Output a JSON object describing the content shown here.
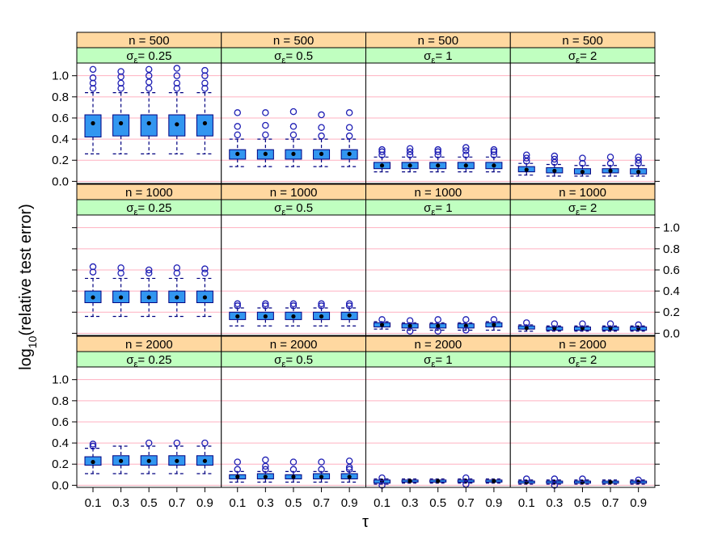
{
  "chart_data": {
    "type": "box",
    "xlabel": "τ",
    "ylabel": "log",
    "ylabel_sub": "10",
    "ylabel_rest": "(relative test error)",
    "strip_prefix_sigma": "σ",
    "strip_sub_eps": "ε",
    "x_ticks": [
      "0.1",
      "0.3",
      "0.5",
      "0.7",
      "0.9"
    ],
    "y_ticks": [
      "0.0",
      "0.2",
      "0.4",
      "0.6",
      "0.8",
      "1.0"
    ],
    "ylim": [
      -0.02,
      1.12
    ],
    "colors": {
      "n_strip": "#ffd8a0",
      "sigma_strip": "#c0ffc0",
      "box_fill": "#3296f0",
      "box_line": "#000080",
      "outlier": "#1e1eb4",
      "grid": "#ffb0c0",
      "panel_bg": "#ffffff"
    },
    "rows": [
      {
        "n_label": "n = 500",
        "panels": [
          {
            "sigma_label": "= 0.25",
            "boxes": [
              {
                "q1": 0.42,
                "med": 0.55,
                "q3": 0.63,
                "lo": 0.26,
                "hi": 0.84,
                "out": [
                  0.88,
                  0.93,
                  0.98,
                  1.06
                ]
              },
              {
                "q1": 0.43,
                "med": 0.55,
                "q3": 0.63,
                "lo": 0.26,
                "hi": 0.84,
                "out": [
                  0.88,
                  0.93,
                  0.99,
                  1.04
                ]
              },
              {
                "q1": 0.43,
                "med": 0.55,
                "q3": 0.63,
                "lo": 0.26,
                "hi": 0.84,
                "out": [
                  0.88,
                  0.94,
                  1.0,
                  1.06
                ]
              },
              {
                "q1": 0.43,
                "med": 0.54,
                "q3": 0.63,
                "lo": 0.26,
                "hi": 0.84,
                "out": [
                  0.88,
                  0.93,
                  1.0,
                  1.07
                ]
              },
              {
                "q1": 0.43,
                "med": 0.55,
                "q3": 0.63,
                "lo": 0.26,
                "hi": 0.84,
                "out": [
                  0.88,
                  0.93,
                  1.0,
                  1.05
                ]
              }
            ]
          },
          {
            "sigma_label": "= 0.5",
            "boxes": [
              {
                "q1": 0.21,
                "med": 0.26,
                "q3": 0.3,
                "lo": 0.14,
                "hi": 0.4,
                "out": [
                  0.44,
                  0.52,
                  0.65
                ]
              },
              {
                "q1": 0.21,
                "med": 0.26,
                "q3": 0.3,
                "lo": 0.14,
                "hi": 0.4,
                "out": [
                  0.44,
                  0.53,
                  0.65
                ]
              },
              {
                "q1": 0.21,
                "med": 0.26,
                "q3": 0.3,
                "lo": 0.14,
                "hi": 0.4,
                "out": [
                  0.44,
                  0.52,
                  0.66
                ]
              },
              {
                "q1": 0.21,
                "med": 0.26,
                "q3": 0.3,
                "lo": 0.14,
                "hi": 0.4,
                "out": [
                  0.43,
                  0.51,
                  0.63
                ]
              },
              {
                "q1": 0.21,
                "med": 0.26,
                "q3": 0.3,
                "lo": 0.14,
                "hi": 0.4,
                "out": [
                  0.43,
                  0.51,
                  0.65
                ]
              }
            ]
          },
          {
            "sigma_label": "= 1",
            "boxes": [
              {
                "q1": 0.12,
                "med": 0.15,
                "q3": 0.18,
                "lo": 0.09,
                "hi": 0.23,
                "out": [
                  0.25,
                  0.28,
                  0.3
                ]
              },
              {
                "q1": 0.12,
                "med": 0.15,
                "q3": 0.18,
                "lo": 0.09,
                "hi": 0.23,
                "out": [
                  0.25,
                  0.28,
                  0.31
                ]
              },
              {
                "q1": 0.12,
                "med": 0.15,
                "q3": 0.18,
                "lo": 0.09,
                "hi": 0.23,
                "out": [
                  0.25,
                  0.28,
                  0.3
                ]
              },
              {
                "q1": 0.12,
                "med": 0.15,
                "q3": 0.18,
                "lo": 0.09,
                "hi": 0.23,
                "out": [
                  0.25,
                  0.29,
                  0.32
                ]
              },
              {
                "q1": 0.12,
                "med": 0.15,
                "q3": 0.18,
                "lo": 0.09,
                "hi": 0.23,
                "out": [
                  0.25,
                  0.28,
                  0.3
                ]
              }
            ]
          },
          {
            "sigma_label": "= 2",
            "boxes": [
              {
                "q1": 0.09,
                "med": 0.11,
                "q3": 0.14,
                "lo": 0.06,
                "hi": 0.17,
                "out": [
                  0.19,
                  0.22,
                  0.25
                ]
              },
              {
                "q1": 0.08,
                "med": 0.1,
                "q3": 0.13,
                "lo": 0.05,
                "hi": 0.16,
                "out": [
                  0.18,
                  0.21,
                  0.24
                ]
              },
              {
                "q1": 0.07,
                "med": 0.09,
                "q3": 0.12,
                "lo": 0.05,
                "hi": 0.15,
                "out": [
                  0.17,
                  0.22
                ]
              },
              {
                "q1": 0.08,
                "med": 0.1,
                "q3": 0.12,
                "lo": 0.05,
                "hi": 0.15,
                "out": [
                  0.17,
                  0.23
                ]
              },
              {
                "q1": 0.07,
                "med": 0.09,
                "q3": 0.12,
                "lo": 0.05,
                "hi": 0.15,
                "out": [
                  0.17,
                  0.2,
                  0.23
                ]
              }
            ]
          }
        ]
      },
      {
        "n_label": "n = 1000",
        "panels": [
          {
            "sigma_label": "= 0.25",
            "boxes": [
              {
                "q1": 0.29,
                "med": 0.34,
                "q3": 0.4,
                "lo": 0.16,
                "hi": 0.52,
                "out": [
                  0.58,
                  0.63
                ]
              },
              {
                "q1": 0.29,
                "med": 0.34,
                "q3": 0.4,
                "lo": 0.16,
                "hi": 0.52,
                "out": [
                  0.57,
                  0.62
                ]
              },
              {
                "q1": 0.29,
                "med": 0.34,
                "q3": 0.4,
                "lo": 0.16,
                "hi": 0.52,
                "out": [
                  0.57,
                  0.6
                ]
              },
              {
                "q1": 0.29,
                "med": 0.34,
                "q3": 0.4,
                "lo": 0.16,
                "hi": 0.52,
                "out": [
                  0.57,
                  0.62
                ]
              },
              {
                "q1": 0.29,
                "med": 0.34,
                "q3": 0.4,
                "lo": 0.16,
                "hi": 0.52,
                "out": [
                  0.57,
                  0.61
                ]
              }
            ]
          },
          {
            "sigma_label": "= 0.5",
            "boxes": [
              {
                "q1": 0.13,
                "med": 0.16,
                "q3": 0.2,
                "lo": 0.07,
                "hi": 0.24,
                "out": [
                  0.26,
                  0.28
                ]
              },
              {
                "q1": 0.13,
                "med": 0.16,
                "q3": 0.2,
                "lo": 0.07,
                "hi": 0.24,
                "out": [
                  0.26,
                  0.28
                ]
              },
              {
                "q1": 0.13,
                "med": 0.16,
                "q3": 0.2,
                "lo": 0.07,
                "hi": 0.24,
                "out": [
                  0.26,
                  0.28
                ]
              },
              {
                "q1": 0.13,
                "med": 0.16,
                "q3": 0.2,
                "lo": 0.07,
                "hi": 0.24,
                "out": [
                  0.26,
                  0.28
                ]
              },
              {
                "q1": 0.13,
                "med": 0.17,
                "q3": 0.2,
                "lo": 0.07,
                "hi": 0.24,
                "out": [
                  0.26,
                  0.28
                ]
              }
            ]
          },
          {
            "sigma_label": "= 1",
            "boxes": [
              {
                "q1": 0.06,
                "med": 0.08,
                "q3": 0.1,
                "lo": 0.04,
                "hi": 0.11,
                "out": [
                  0.13
                ]
              },
              {
                "q1": 0.05,
                "med": 0.07,
                "q3": 0.09,
                "lo": 0.03,
                "hi": 0.1,
                "out": [
                  0.02,
                  0.12
                ]
              },
              {
                "q1": 0.05,
                "med": 0.07,
                "q3": 0.09,
                "lo": 0.03,
                "hi": 0.1,
                "out": [
                  0.02,
                  0.13
                ]
              },
              {
                "q1": 0.05,
                "med": 0.07,
                "q3": 0.09,
                "lo": 0.03,
                "hi": 0.1,
                "out": [
                  0.03,
                  0.13
                ]
              },
              {
                "q1": 0.06,
                "med": 0.08,
                "q3": 0.1,
                "lo": 0.03,
                "hi": 0.11,
                "out": [
                  0.13
                ]
              }
            ]
          },
          {
            "sigma_label": "= 2",
            "boxes": [
              {
                "q1": 0.04,
                "med": 0.05,
                "q3": 0.07,
                "lo": 0.02,
                "hi": 0.08,
                "out": [
                  0.1
                ]
              },
              {
                "q1": 0.03,
                "med": 0.05,
                "q3": 0.06,
                "lo": 0.02,
                "hi": 0.07,
                "out": [
                  0.09
                ]
              },
              {
                "q1": 0.03,
                "med": 0.05,
                "q3": 0.06,
                "lo": 0.02,
                "hi": 0.07,
                "out": [
                  0.09
                ]
              },
              {
                "q1": 0.03,
                "med": 0.05,
                "q3": 0.06,
                "lo": 0.02,
                "hi": 0.07,
                "out": [
                  0.09
                ]
              },
              {
                "q1": 0.03,
                "med": 0.05,
                "q3": 0.06,
                "lo": 0.02,
                "hi": 0.07,
                "out": [
                  0.08
                ]
              }
            ]
          }
        ]
      },
      {
        "n_label": "n = 2000",
        "panels": [
          {
            "sigma_label": "= 0.25",
            "boxes": [
              {
                "q1": 0.19,
                "med": 0.22,
                "q3": 0.27,
                "lo": 0.11,
                "hi": 0.35,
                "out": [
                  0.37,
                  0.39
                ]
              },
              {
                "q1": 0.19,
                "med": 0.23,
                "q3": 0.28,
                "lo": 0.11,
                "hi": 0.37,
                "out": []
              },
              {
                "q1": 0.19,
                "med": 0.23,
                "q3": 0.28,
                "lo": 0.11,
                "hi": 0.37,
                "out": [
                  0.4
                ]
              },
              {
                "q1": 0.19,
                "med": 0.23,
                "q3": 0.28,
                "lo": 0.11,
                "hi": 0.37,
                "out": [
                  0.4
                ]
              },
              {
                "q1": 0.19,
                "med": 0.23,
                "q3": 0.28,
                "lo": 0.11,
                "hi": 0.37,
                "out": [
                  0.4
                ]
              }
            ]
          },
          {
            "sigma_label": "= 0.5",
            "boxes": [
              {
                "q1": 0.06,
                "med": 0.08,
                "q3": 0.1,
                "lo": 0.03,
                "hi": 0.13,
                "out": [
                  0.15,
                  0.22
                ]
              },
              {
                "q1": 0.06,
                "med": 0.08,
                "q3": 0.11,
                "lo": 0.03,
                "hi": 0.13,
                "out": [
                  0.15,
                  0.18,
                  0.24
                ]
              },
              {
                "q1": 0.06,
                "med": 0.08,
                "q3": 0.1,
                "lo": 0.03,
                "hi": 0.13,
                "out": [
                  0.15,
                  0.22
                ]
              },
              {
                "q1": 0.06,
                "med": 0.08,
                "q3": 0.11,
                "lo": 0.03,
                "hi": 0.13,
                "out": [
                  0.15,
                  0.22
                ]
              },
              {
                "q1": 0.06,
                "med": 0.08,
                "q3": 0.11,
                "lo": 0.03,
                "hi": 0.13,
                "out": [
                  0.15,
                  0.17,
                  0.23
                ]
              }
            ]
          },
          {
            "sigma_label": "= 1",
            "boxes": [
              {
                "q1": 0.02,
                "med": 0.04,
                "q3": 0.05,
                "lo": 0.01,
                "hi": 0.06,
                "out": [
                  0.0,
                  0.07
                ]
              },
              {
                "q1": 0.03,
                "med": 0.04,
                "q3": 0.05,
                "lo": 0.02,
                "hi": 0.06,
                "out": []
              },
              {
                "q1": 0.03,
                "med": 0.04,
                "q3": 0.05,
                "lo": 0.02,
                "hi": 0.06,
                "out": []
              },
              {
                "q1": 0.03,
                "med": 0.04,
                "q3": 0.05,
                "lo": 0.02,
                "hi": 0.06,
                "out": [
                  0.01,
                  0.07
                ]
              },
              {
                "q1": 0.03,
                "med": 0.04,
                "q3": 0.05,
                "lo": 0.02,
                "hi": 0.06,
                "out": []
              }
            ]
          },
          {
            "sigma_label": "= 2",
            "boxes": [
              {
                "q1": 0.02,
                "med": 0.03,
                "q3": 0.04,
                "lo": 0.01,
                "hi": 0.05,
                "out": [
                  0.06
                ]
              },
              {
                "q1": 0.02,
                "med": 0.03,
                "q3": 0.04,
                "lo": 0.01,
                "hi": 0.05,
                "out": [
                  0.0,
                  0.06
                ]
              },
              {
                "q1": 0.02,
                "med": 0.03,
                "q3": 0.04,
                "lo": 0.01,
                "hi": 0.05,
                "out": [
                  0.06
                ]
              },
              {
                "q1": 0.02,
                "med": 0.03,
                "q3": 0.04,
                "lo": 0.01,
                "hi": 0.05,
                "out": []
              },
              {
                "q1": 0.02,
                "med": 0.03,
                "q3": 0.04,
                "lo": 0.01,
                "hi": 0.05,
                "out": [
                  0.05
                ]
              }
            ]
          }
        ]
      }
    ]
  }
}
